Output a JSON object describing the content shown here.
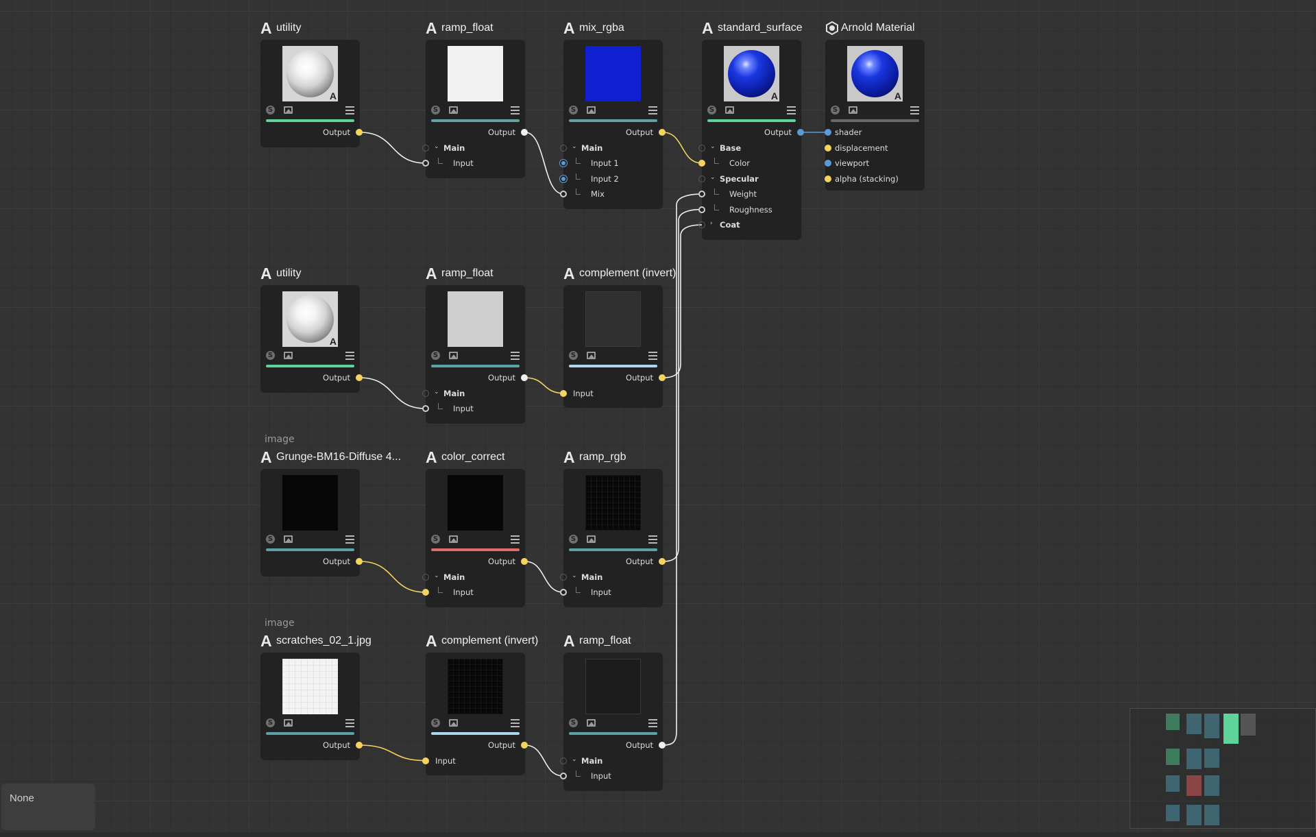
{
  "status_text": "None",
  "nodes": [
    {
      "id": "n_utility1",
      "logo": "arnold-a",
      "title": "utility",
      "caption": "",
      "thumb": "sphere-white",
      "bar_color": "#5ed39a",
      "outputs": [
        {
          "label": "Output",
          "color": "#f4d35e"
        }
      ],
      "inputs": []
    },
    {
      "id": "n_ramp1",
      "logo": "arnold-a",
      "title": "ramp_float",
      "caption": "",
      "thumb": "white",
      "bar_color": "#5aa3a6",
      "outputs": [
        {
          "label": "Output",
          "color": "#f0f0f0"
        }
      ],
      "inputs": [
        {
          "label": "Main",
          "group": true
        },
        {
          "label": "Input"
        }
      ]
    },
    {
      "id": "n_mix",
      "logo": "arnold-a",
      "title": "mix_rgba",
      "caption": "",
      "thumb": "blue",
      "bar_color": "#5aa3a6",
      "outputs": [
        {
          "label": "Output",
          "color": "#f4d35e"
        }
      ],
      "inputs": [
        {
          "label": "Main",
          "group": true
        },
        {
          "label": "Input 1"
        },
        {
          "label": "Input 2"
        },
        {
          "label": "Mix"
        }
      ]
    },
    {
      "id": "n_std",
      "logo": "arnold-a",
      "title": "standard_surface",
      "caption": "",
      "thumb": "sphere-blue",
      "bar_color": "#5ed39a",
      "outputs": [
        {
          "label": "Output",
          "color": "#5b9bd5"
        }
      ],
      "inputs": [
        {
          "label": "Base",
          "group": true
        },
        {
          "label": "Color"
        },
        {
          "label": "Specular",
          "group": true
        },
        {
          "label": "Weight"
        },
        {
          "label": "Roughness"
        },
        {
          "label": "Coat",
          "group": true
        }
      ]
    },
    {
      "id": "n_mat",
      "logo": "arnold-material",
      "title": "Arnold Material",
      "caption": "",
      "thumb": "sphere-blue",
      "bar_color": "#6a6a6a",
      "outputs": [],
      "inputs": [
        {
          "label": "shader"
        },
        {
          "label": "displacement"
        },
        {
          "label": "viewport"
        },
        {
          "label": "alpha (stacking)"
        }
      ]
    },
    {
      "id": "n_utility2",
      "logo": "arnold-a",
      "title": "utility",
      "caption": "",
      "thumb": "sphere-white",
      "bar_color": "#5ed39a",
      "outputs": [
        {
          "label": "Output",
          "color": "#f4d35e"
        }
      ],
      "inputs": []
    },
    {
      "id": "n_ramp2",
      "logo": "arnold-a",
      "title": "ramp_float",
      "caption": "",
      "thumb": "lightgray",
      "bar_color": "#5aa3a6",
      "outputs": [
        {
          "label": "Output",
          "color": "#f0f0f0"
        }
      ],
      "inputs": [
        {
          "label": "Main",
          "group": true
        },
        {
          "label": "Input"
        }
      ]
    },
    {
      "id": "n_comp1",
      "logo": "arnold-a",
      "title": "complement (invert)",
      "caption": "",
      "thumb": "darkgray",
      "bar_color": "#a8d8f0",
      "outputs": [
        {
          "label": "Output",
          "color": "#f4d35e"
        }
      ],
      "inputs": [
        {
          "label": "Input"
        }
      ]
    },
    {
      "id": "n_grunge",
      "logo": "arnold-a",
      "title": "Grunge-BM16-Diffuse 4...",
      "caption": "image",
      "thumb": "black",
      "bar_color": "#5aa3a6",
      "outputs": [
        {
          "label": "Output",
          "color": "#f4d35e"
        }
      ],
      "inputs": []
    },
    {
      "id": "n_cc",
      "logo": "arnold-a",
      "title": "color_correct",
      "caption": "",
      "thumb": "black",
      "bar_color": "#e06c6c",
      "outputs": [
        {
          "label": "Output",
          "color": "#f4d35e"
        }
      ],
      "inputs": [
        {
          "label": "Main",
          "group": true
        },
        {
          "label": "Input"
        }
      ]
    },
    {
      "id": "n_rrgb",
      "logo": "arnold-a",
      "title": "ramp_rgb",
      "caption": "",
      "thumb": "black-texture",
      "bar_color": "#5aa3a6",
      "outputs": [
        {
          "label": "Output",
          "color": "#f4d35e"
        }
      ],
      "inputs": [
        {
          "label": "Main",
          "group": true
        },
        {
          "label": "Input"
        }
      ]
    },
    {
      "id": "n_scratch",
      "logo": "arnold-a",
      "title": "scratches_02_1.jpg",
      "caption": "image",
      "thumb": "white-texture",
      "bar_color": "#5aa3a6",
      "outputs": [
        {
          "label": "Output",
          "color": "#f4d35e"
        }
      ],
      "inputs": []
    },
    {
      "id": "n_comp2",
      "logo": "arnold-a",
      "title": "complement (invert)",
      "caption": "",
      "thumb": "black-texture",
      "bar_color": "#a8d8f0",
      "outputs": [
        {
          "label": "Output",
          "color": "#f4d35e"
        }
      ],
      "inputs": [
        {
          "label": "Input"
        }
      ]
    },
    {
      "id": "n_ramp3",
      "logo": "arnold-a",
      "title": "ramp_float",
      "caption": "",
      "thumb": "charcoal",
      "bar_color": "#5aa3a6",
      "outputs": [
        {
          "label": "Output",
          "color": "#f0f0f0"
        }
      ],
      "inputs": [
        {
          "label": "Main",
          "group": true
        },
        {
          "label": "Input"
        }
      ]
    }
  ],
  "connections": [
    {
      "from": "n_utility1",
      "to": "n_ramp1",
      "to_input": "Input",
      "color": "#f0f0f0"
    },
    {
      "from": "n_ramp1",
      "to": "n_mix",
      "to_input": "Mix",
      "color": "#f0f0f0"
    },
    {
      "from": "n_mix",
      "to": "n_std",
      "to_input": "Color",
      "color": "#f4d35e"
    },
    {
      "from": "n_std",
      "to": "n_mat",
      "to_input": "shader",
      "color": "#5b9bd5"
    },
    {
      "from": "n_utility2",
      "to": "n_ramp2",
      "to_input": "Input",
      "color": "#f0f0f0"
    },
    {
      "from": "n_ramp2",
      "to": "n_comp1",
      "to_input": "Input",
      "color": "#f4d35e"
    },
    {
      "from": "n_comp1",
      "to": "n_std",
      "to_input": "Coat",
      "color": "#f0f0f0"
    },
    {
      "from": "n_grunge",
      "to": "n_cc",
      "to_input": "Input",
      "color": "#f4d35e"
    },
    {
      "from": "n_cc",
      "to": "n_rrgb",
      "to_input": "Input",
      "color": "#f0f0f0"
    },
    {
      "from": "n_rrgb",
      "to": "n_std",
      "to_input": "Roughness",
      "color": "#f0f0f0"
    },
    {
      "from": "n_scratch",
      "to": "n_comp2",
      "to_input": "Input",
      "color": "#f4d35e"
    },
    {
      "from": "n_comp2",
      "to": "n_ramp3",
      "to_input": "Input",
      "color": "#f0f0f0"
    },
    {
      "from": "n_ramp3",
      "to": "n_std",
      "to_input": "Weight",
      "color": "#f0f0f0"
    }
  ],
  "minimap": {
    "colors": [
      "#3f7a5c",
      "#3f6670",
      "#3f6670",
      "#5ed39a",
      "#555555",
      "#8a4545"
    ]
  }
}
